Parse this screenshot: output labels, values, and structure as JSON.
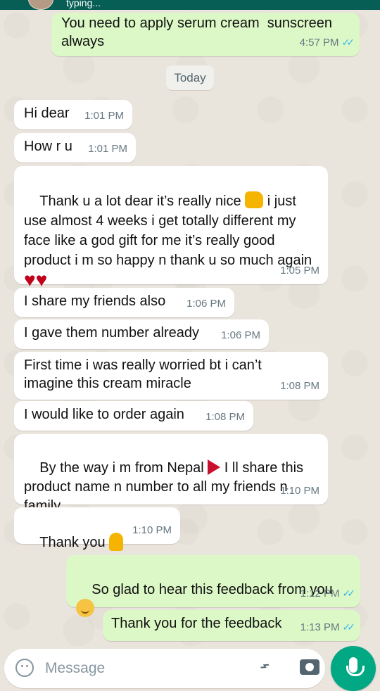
{
  "header": {
    "status": "typing..."
  },
  "date_chip": "Today",
  "messages": [
    {
      "dir": "out",
      "text": "You need to apply serum cream  sunscreen always",
      "time": "4:57 PM",
      "ticks": true
    },
    {
      "dir": "in",
      "text": "Hi dear",
      "time": "1:01 PM"
    },
    {
      "dir": "in",
      "text": "How r u",
      "time": "1:01 PM"
    },
    {
      "dir": "in",
      "text": "Thank u a lot dear it’s really nice 👍 i just use almost 4 weeks i get totally different my face like a god gift for me it’s really good product i m so happy n thank u so much again ❤️❤️ ❤️❤️❤️",
      "time": "1:05 PM"
    },
    {
      "dir": "in",
      "text": "I share my friends also",
      "time": "1:06 PM"
    },
    {
      "dir": "in",
      "text": "I gave them number already",
      "time": "1:06 PM"
    },
    {
      "dir": "in",
      "text": "First time i was really worried bt i can’t imagine this cream miracle",
      "time": "1:08 PM"
    },
    {
      "dir": "in",
      "text": "I would like to order again",
      "time": "1:08 PM"
    },
    {
      "dir": "in",
      "text": "By the way i m from Nepal 🇳🇵 I ll share this product name n number to all my friends n family",
      "time": "1:10 PM"
    },
    {
      "dir": "in",
      "text": "Thank you 🙏",
      "time": "1:10 PM"
    },
    {
      "dir": "out",
      "text": "So glad to hear this feedback from you ☺️",
      "time": "1:12 PM",
      "ticks": true
    },
    {
      "dir": "out",
      "text": "Thank you for the feedback",
      "time": "1:13 PM",
      "ticks": true
    }
  ],
  "composer": {
    "placeholder": "Message"
  },
  "icons": [
    "emoji-icon",
    "attach-icon",
    "camera-icon",
    "mic-icon",
    "double-check-icon"
  ]
}
